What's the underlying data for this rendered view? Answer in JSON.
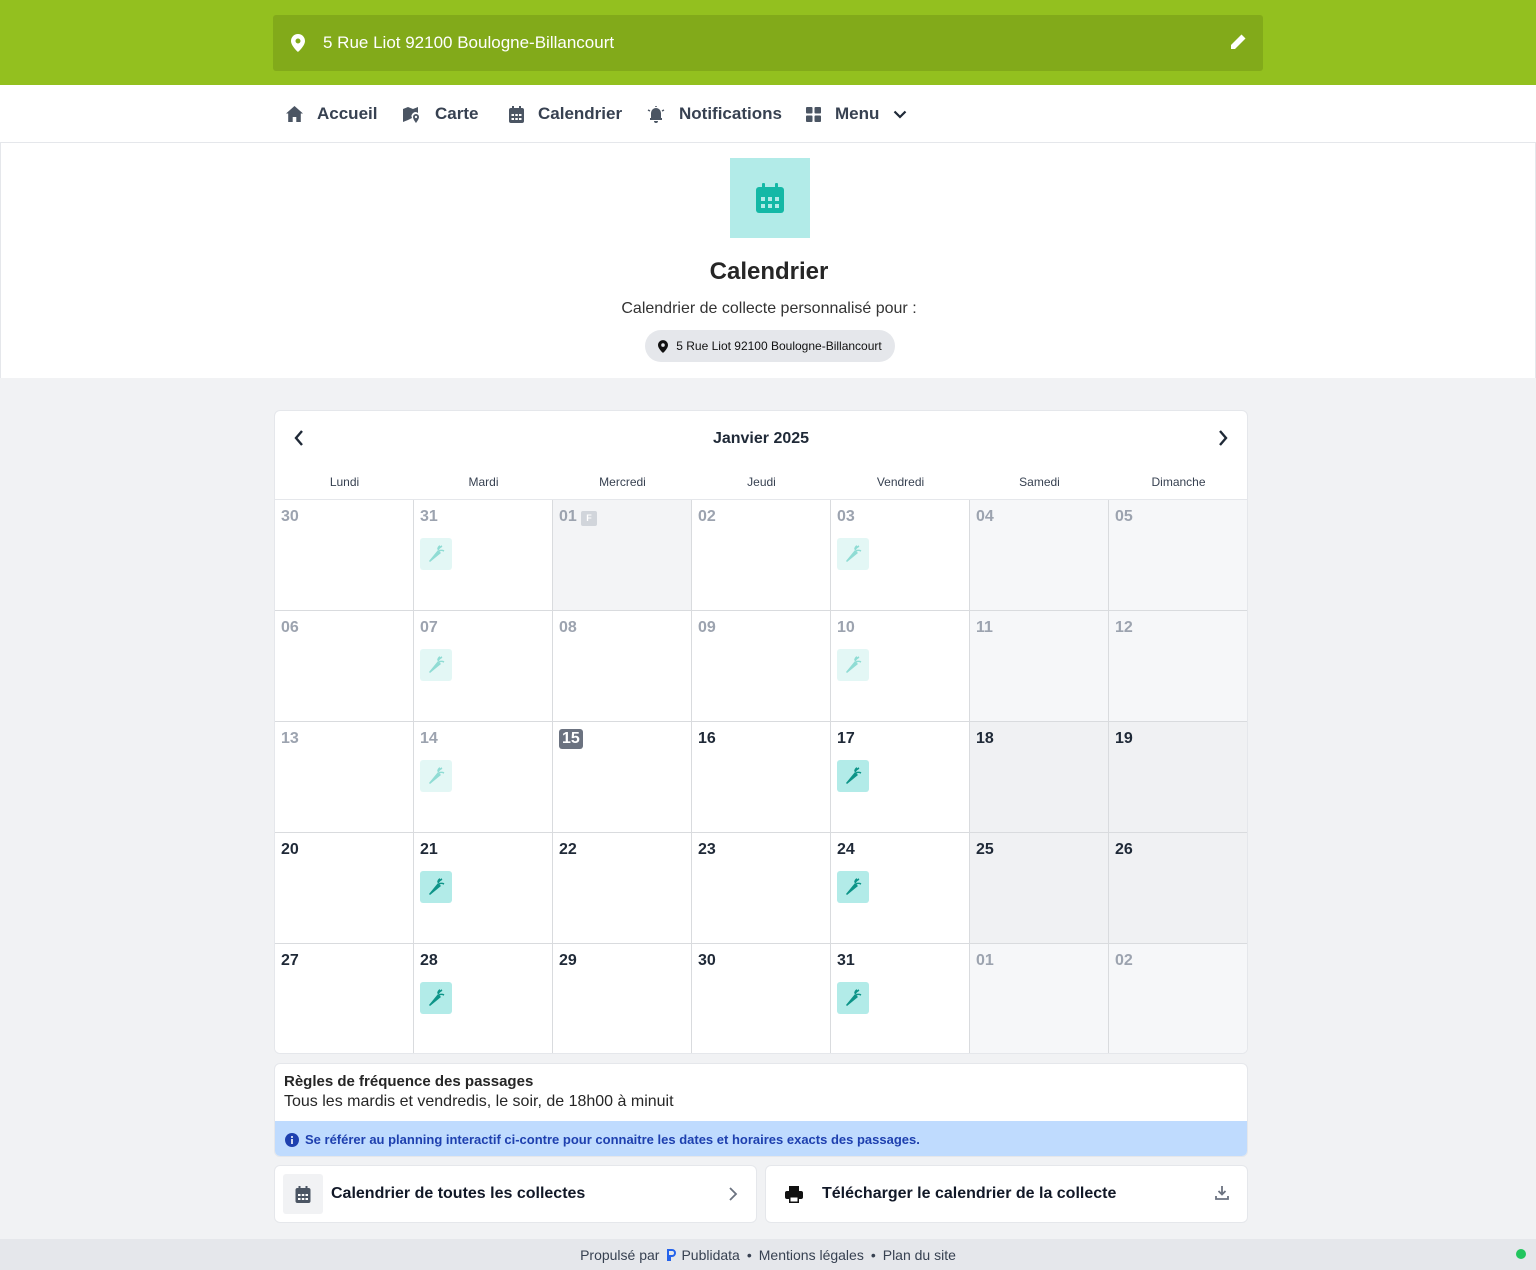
{
  "address": {
    "text": "5 Rue Liot 92100 Boulogne-Billancourt"
  },
  "nav": {
    "items": [
      {
        "label": "Accueil",
        "icon": "home-icon"
      },
      {
        "label": "Carte",
        "icon": "map-icon"
      },
      {
        "label": "Calendrier",
        "icon": "calendar-icon"
      },
      {
        "label": "Notifications",
        "icon": "alarm-bell-icon"
      },
      {
        "label": "Menu",
        "icon": "grid-icon"
      }
    ]
  },
  "hero": {
    "title": "Calendrier",
    "subtitle": "Calendrier de collecte personnalisé pour :",
    "chip": "5 Rue Liot 92100 Boulogne-Billancourt"
  },
  "calendar": {
    "month": "Janvier 2025",
    "weekdays": [
      "Lundi",
      "Mardi",
      "Mercredi",
      "Jeudi",
      "Vendredi",
      "Samedi",
      "Dimanche"
    ],
    "holiday_tag": "F",
    "weeks": [
      [
        {
          "day": "30",
          "state": "past"
        },
        {
          "day": "31",
          "state": "past",
          "pickup": true
        },
        {
          "day": "01",
          "state": "past",
          "holiday": true
        },
        {
          "day": "02",
          "state": "past"
        },
        {
          "day": "03",
          "state": "past",
          "pickup": true
        },
        {
          "day": "04",
          "state": "past-weekend"
        },
        {
          "day": "05",
          "state": "past-weekend"
        }
      ],
      [
        {
          "day": "06",
          "state": "past"
        },
        {
          "day": "07",
          "state": "past",
          "pickup": true
        },
        {
          "day": "08",
          "state": "past"
        },
        {
          "day": "09",
          "state": "past"
        },
        {
          "day": "10",
          "state": "past",
          "pickup": true
        },
        {
          "day": "11",
          "state": "past-weekend"
        },
        {
          "day": "12",
          "state": "past-weekend"
        }
      ],
      [
        {
          "day": "13",
          "state": "past"
        },
        {
          "day": "14",
          "state": "past",
          "pickup": true
        },
        {
          "day": "15",
          "state": "today"
        },
        {
          "day": "16",
          "state": "future"
        },
        {
          "day": "17",
          "state": "future",
          "pickup": true
        },
        {
          "day": "18",
          "state": "weekend"
        },
        {
          "day": "19",
          "state": "weekend"
        }
      ],
      [
        {
          "day": "20",
          "state": "future"
        },
        {
          "day": "21",
          "state": "future",
          "pickup": true
        },
        {
          "day": "22",
          "state": "future"
        },
        {
          "day": "23",
          "state": "future"
        },
        {
          "day": "24",
          "state": "future",
          "pickup": true
        },
        {
          "day": "25",
          "state": "weekend"
        },
        {
          "day": "26",
          "state": "weekend"
        }
      ],
      [
        {
          "day": "27",
          "state": "future"
        },
        {
          "day": "28",
          "state": "future",
          "pickup": true
        },
        {
          "day": "29",
          "state": "future"
        },
        {
          "day": "30",
          "state": "future"
        },
        {
          "day": "31",
          "state": "future",
          "pickup": true
        },
        {
          "day": "01",
          "state": "next-month"
        },
        {
          "day": "02",
          "state": "next-month"
        }
      ]
    ],
    "pickup_icon": "carrot-icon"
  },
  "rules": {
    "title": "Règles de fréquence des passages",
    "text": "Tous les mardis et vendredis, le soir, de 18h00 à minuit",
    "info": "Se référer au planning interactif ci-contre pour connaitre les dates et horaires exacts des passages."
  },
  "actions": {
    "all_collections": "Calendrier de toutes les collectes",
    "download": "Télécharger le calendrier de la collecte"
  },
  "footer": {
    "powered_prefix": "Propulsé par",
    "powered_brand": "Publidata",
    "legal": "Mentions légales",
    "sitemap": "Plan du site",
    "separator": "•"
  },
  "colors": {
    "brand_green": "#93c01f",
    "brand_green_dark": "#82aa1a",
    "teal": "#14b8a6",
    "teal_bg": "#b2ebe8",
    "info_bg": "#bfdbfe",
    "info_text": "#1e40af"
  }
}
